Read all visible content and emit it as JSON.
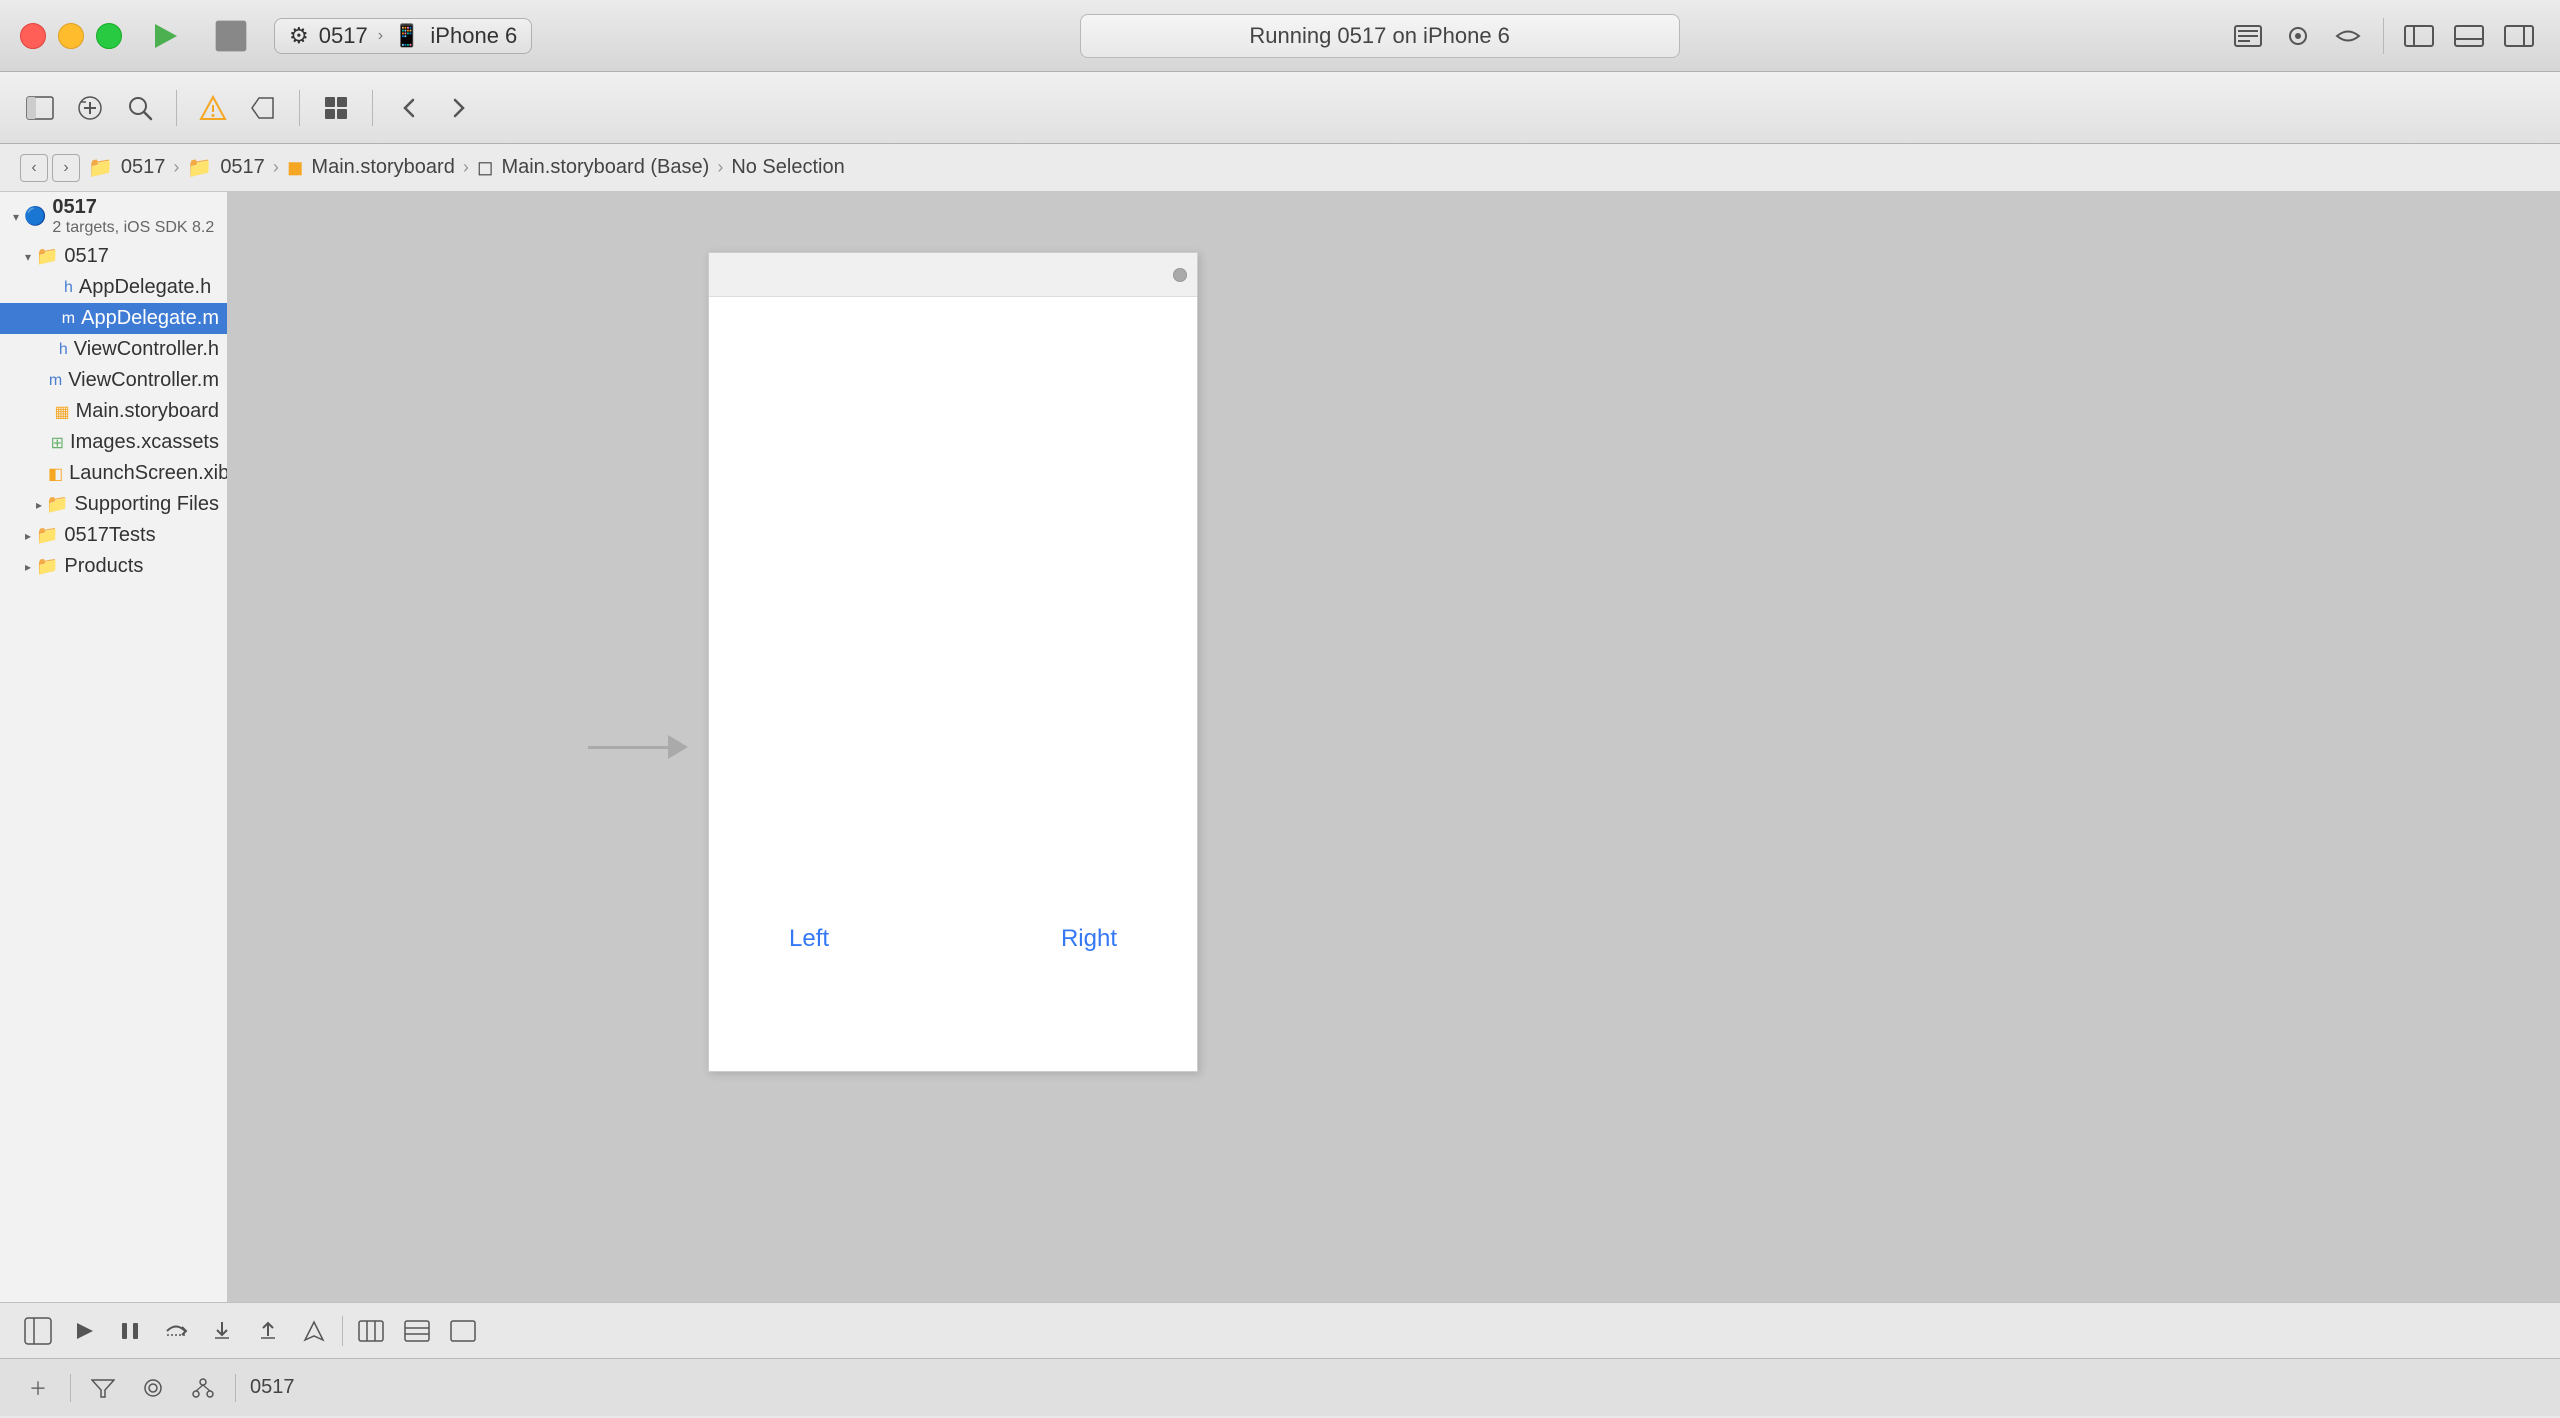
{
  "titlebar": {
    "scheme_label": "0517",
    "device_label": "iPhone 6",
    "running_label": "Running 0517 on iPhone 6"
  },
  "breadcrumb": {
    "items": [
      "0517",
      "0517",
      "Main.storyboard",
      "Main.storyboard (Base)",
      "No Selection"
    ]
  },
  "sidebar": {
    "project_name": "0517",
    "project_subtitle": "2 targets, iOS SDK 8.2",
    "group_name": "0517",
    "files": [
      {
        "name": "AppDelegate.h",
        "type": "h",
        "indent": 2
      },
      {
        "name": "AppDelegate.m",
        "type": "m",
        "indent": 2,
        "selected": true
      },
      {
        "name": "ViewController.h",
        "type": "h",
        "indent": 2
      },
      {
        "name": "ViewController.m",
        "type": "m",
        "indent": 2
      },
      {
        "name": "Main.storyboard",
        "type": "storyboard",
        "indent": 2
      },
      {
        "name": "Images.xcassets",
        "type": "xcassets",
        "indent": 2
      },
      {
        "name": "LaunchScreen.xib",
        "type": "xib",
        "indent": 2
      }
    ],
    "supporting_files": "Supporting Files",
    "tests_group": "0517Tests",
    "products_group": "Products"
  },
  "storyboard": {
    "left_button": "Left",
    "right_button": "Right"
  },
  "bottom_bar": {
    "scheme_label": "0517"
  }
}
